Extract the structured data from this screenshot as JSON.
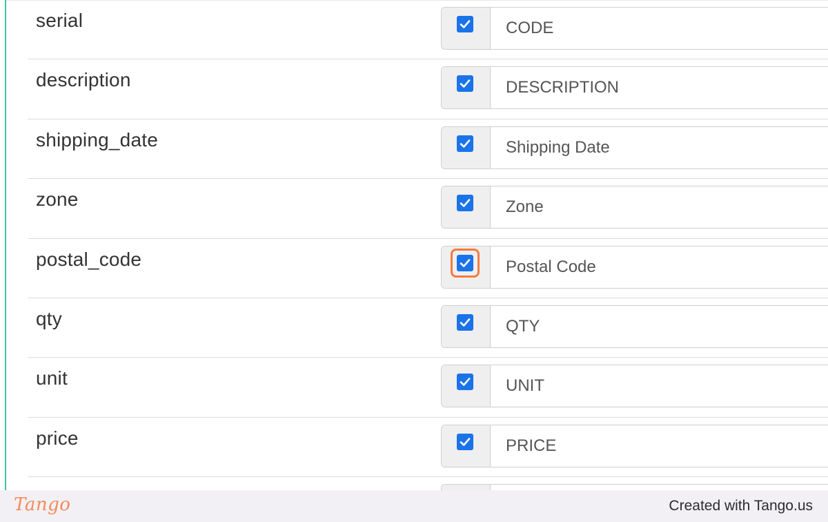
{
  "fields": [
    {
      "name": "serial",
      "label": "CODE",
      "checked": true
    },
    {
      "name": "description",
      "label": "DESCRIPTION",
      "checked": true
    },
    {
      "name": "shipping_date",
      "label": "Shipping Date",
      "checked": true
    },
    {
      "name": "zone",
      "label": "Zone",
      "checked": true
    },
    {
      "name": "postal_code",
      "label": "Postal Code",
      "checked": true,
      "highlighted": true
    },
    {
      "name": "qty",
      "label": "QTY",
      "checked": true
    },
    {
      "name": "unit",
      "label": "UNIT",
      "checked": true
    },
    {
      "name": "price",
      "label": "PRICE",
      "checked": true
    },
    {
      "name": "",
      "label": "",
      "checked": false
    }
  ],
  "colors": {
    "checkbox": "#1a73e8",
    "highlight": "#f47a3e",
    "accent_bar": "#3cc5a4"
  },
  "footer": {
    "logo": "Tango",
    "credit": "Created with Tango.us"
  }
}
